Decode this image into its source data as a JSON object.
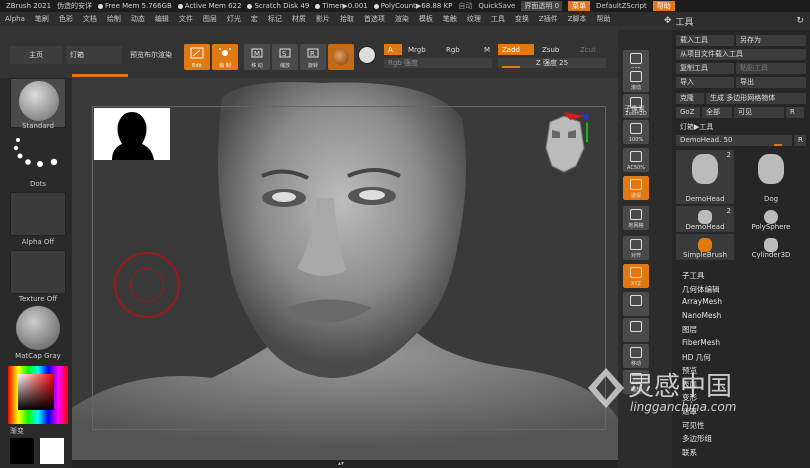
{
  "titlebar": {
    "app": "ZBrush 2021",
    "doc": "伪造的安详",
    "free_mem": "Free Mem 5.766GB",
    "active_mem": "Active Mem 622",
    "scratch": "Scratch Disk 49",
    "timer": "Timer▶0.001",
    "polycount": "PolyCount▶68.88 KP",
    "auto": "自动",
    "quicksave": "QuickSave",
    "transparency": "界面透明 0",
    "menu_btn": "菜单",
    "script": "DefaultZScript",
    "help": "帮助"
  },
  "menubar": [
    "Alpha",
    "笔刷",
    "色彩",
    "文档",
    "绘制",
    "动态",
    "编辑",
    "文件",
    "图层",
    "灯光",
    "宏",
    "标记",
    "材质",
    "影片",
    "拾取",
    "首选项",
    "渲染",
    "模板",
    "笔触",
    "纹理",
    "工具",
    "变换",
    "Z插件",
    "Z脚本",
    "帮助"
  ],
  "tool_header": "工具",
  "shelf": {
    "home": "主页",
    "lightbox": "灯箱",
    "preview": "预览布尔渲染",
    "edit": "Edit",
    "draw": "绘 制",
    "move": "移 动",
    "scale": "缩放",
    "rotate": "旋转",
    "rgb_a": "A",
    "mrgb": "Mrgb",
    "rgb": "Rgb",
    "m": "M",
    "zadd": "Zadd",
    "zsub": "Zsub",
    "zcut": "Zcut",
    "rgb_intensity": "Rgb 强度",
    "z_intensity": "Z 强度 25"
  },
  "left_panel": {
    "brush": "Standard",
    "stroke": "Dots",
    "alpha": "Alpha Off",
    "texture": "Texture Off",
    "material": "MatCap Gray",
    "gradient": "渐变"
  },
  "right_column": [
    "BPR",
    "子像素",
    "滚动",
    "缩放",
    "100%",
    "AC50%",
    "透视",
    "地网格",
    "对齐",
    "XYZ",
    "",
    "",
    "",
    "",
    ""
  ],
  "right_column_items": [
    {
      "label": "BPR",
      "active": false
    },
    {
      "label": "滚动",
      "active": false
    },
    {
      "label": "Zoom2D",
      "active": false
    },
    {
      "label": "100%",
      "active": false
    },
    {
      "label": "AC50%",
      "active": false
    },
    {
      "label": "透视",
      "active": true
    },
    {
      "label": "地网格",
      "active": false
    },
    {
      "label": "对齐",
      "active": false
    },
    {
      "label": "XYZ",
      "active": true
    },
    {
      "label": "",
      "active": false
    },
    {
      "label": "",
      "active": false
    },
    {
      "label": "移动",
      "active": false
    },
    {
      "label": "缩放",
      "active": false
    }
  ],
  "right_column_subpixel": "子像素",
  "tool_panel": {
    "load": "载入工具",
    "save_as": "另存为",
    "import_project": "从项目文件载入工具",
    "copy": "复制工具",
    "paste": "粘贴工具",
    "import": "导入",
    "export": "导出",
    "clone": "克隆",
    "make_polymesh": "生成 多边形网格物体",
    "goz": "GoZ",
    "all": "全部",
    "visible": "可见",
    "r": "R",
    "lightbox_tools": "灯箱▶工具",
    "demohead_slider": "DemoHead. 50",
    "thumbs": [
      {
        "name": "DemoHead",
        "count": "2"
      },
      {
        "name": "Dog",
        "count": ""
      },
      {
        "name": "DemoHead",
        "count": "2"
      },
      {
        "name": "PolySphere",
        "count": ""
      },
      {
        "name": "SimpleBrush",
        "count": ""
      },
      {
        "name": "Cylinder3D",
        "count": ""
      }
    ],
    "subpalettes": [
      "子工具",
      "几何体编辑",
      "ArrayMesh",
      "NanoMesh",
      "图层",
      "FiberMesh",
      "HD 几何",
      "预览",
      "表面",
      "变形",
      "遮罩",
      "可见性",
      "多边形组",
      "联系"
    ]
  },
  "watermark": {
    "title": "灵感中国",
    "url": "lingganchina.com"
  },
  "colors": {
    "accent": "#e07a10",
    "bg": "#2b2b2b"
  }
}
